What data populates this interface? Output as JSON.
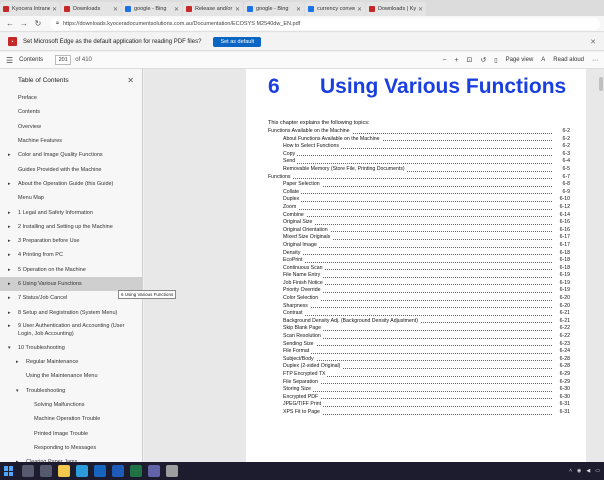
{
  "tabs": [
    {
      "title": "Kyocera Intranet - K",
      "color": "#c62828"
    },
    {
      "title": "Downloads",
      "color": "#c62828"
    },
    {
      "title": "google - Bing",
      "color": "#1a73e8"
    },
    {
      "title": "Release and/or which",
      "color": "#c62828"
    },
    {
      "title": "google - Bing",
      "color": "#1a73e8"
    },
    {
      "title": "currency converter - ",
      "color": "#1a73e8"
    },
    {
      "title": "Downloads | Kyocera",
      "color": "#c62828"
    }
  ],
  "address": {
    "url": "https://downloads.kyoceradocumentsolutions.com.au/Documentation/ECOSYS M2540dw_EN.pdf"
  },
  "infobar": {
    "message": "Set Microsoft Edge as the default application for reading PDF files?",
    "button": "Set as default"
  },
  "pdf_toolbar": {
    "contents_label": "Contents",
    "page_current": "201",
    "page_total": "of 410",
    "page_view": "Page view",
    "read_aloud": "Read aloud"
  },
  "sidebar": {
    "title": "Table of Contents",
    "items": [
      {
        "label": "Preface",
        "level": 0,
        "caret": ""
      },
      {
        "label": "Contents",
        "level": 0,
        "caret": ""
      },
      {
        "label": "Overview",
        "level": 0,
        "caret": ""
      },
      {
        "label": "Machine Features",
        "level": 0,
        "caret": ""
      },
      {
        "label": "Color and Image Quality Functions",
        "level": 0,
        "caret": "▸"
      },
      {
        "label": "Guides Provided with the Machine",
        "level": 0,
        "caret": ""
      },
      {
        "label": "About the Operation Guide (this Guide)",
        "level": 0,
        "caret": "▸"
      },
      {
        "label": "Menu Map",
        "level": 0,
        "caret": ""
      },
      {
        "label": "1 Legal and Safety Information",
        "level": 0,
        "caret": "▸"
      },
      {
        "label": "2 Installing and Setting up the Machine",
        "level": 0,
        "caret": "▸"
      },
      {
        "label": "3 Preparation before Use",
        "level": 0,
        "caret": "▸"
      },
      {
        "label": "4 Printing from PC",
        "level": 0,
        "caret": "▸"
      },
      {
        "label": "5 Operation on the Machine",
        "level": 0,
        "caret": "▸"
      },
      {
        "label": "6 Using Various Functions",
        "level": 0,
        "caret": "▸",
        "selected": true
      },
      {
        "label": "7 Status/Job Cancel",
        "level": 0,
        "caret": "▸"
      },
      {
        "label": "8 Setup and Registration (System Menu)",
        "level": 0,
        "caret": "▸"
      },
      {
        "label": "9 User Authentication and Accounting (User Login, Job Accounting)",
        "level": 0,
        "caret": "▸",
        "tall": true
      },
      {
        "label": "10 Troubleshooting",
        "level": 0,
        "caret": "▾"
      },
      {
        "label": "Regular Maintenance",
        "level": 1,
        "caret": "▸"
      },
      {
        "label": "Using the Maintenance Menu",
        "level": 1,
        "caret": ""
      },
      {
        "label": "Troubleshooting",
        "level": 1,
        "caret": "▾"
      },
      {
        "label": "Solving Malfunctions",
        "level": 2,
        "caret": ""
      },
      {
        "label": "Machine Operation Trouble",
        "level": 2,
        "caret": ""
      },
      {
        "label": "Printed Image Trouble",
        "level": 2,
        "caret": ""
      },
      {
        "label": "Responding to Messages",
        "level": 2,
        "caret": ""
      },
      {
        "label": "Clearing Paper Jams",
        "level": 1,
        "caret": "▸"
      }
    ],
    "tooltip": "6 Using Various Functions"
  },
  "document": {
    "chapter_number": "6",
    "chapter_title": "Using Various Functions",
    "intro": "This chapter explains the following topics:",
    "toc": [
      {
        "text": "Functions Available on the Machine",
        "page": "6-2",
        "level": 0
      },
      {
        "text": "About Functions Available on the Machine",
        "page": "6-2",
        "level": 1
      },
      {
        "text": "How to Select Functions",
        "page": "6-2",
        "level": 1
      },
      {
        "text": "Copy",
        "page": "6-3",
        "level": 1
      },
      {
        "text": "Send",
        "page": "6-4",
        "level": 1
      },
      {
        "text": "Removable Memory (Store File, Printing Documents)",
        "page": "6-5",
        "level": 1
      },
      {
        "text": "Functions",
        "page": "6-7",
        "level": 0
      },
      {
        "text": "Paper Selection",
        "page": "6-8",
        "level": 1
      },
      {
        "text": "Collate",
        "page": "6-9",
        "level": 1
      },
      {
        "text": "Duplex",
        "page": "6-10",
        "level": 1
      },
      {
        "text": "Zoom",
        "page": "6-12",
        "level": 1
      },
      {
        "text": "Combine",
        "page": "6-14",
        "level": 1
      },
      {
        "text": "Original Size",
        "page": "6-16",
        "level": 1
      },
      {
        "text": "Original Orientation",
        "page": "6-16",
        "level": 1
      },
      {
        "text": "Mixed Size Originals",
        "page": "6-17",
        "level": 1
      },
      {
        "text": "Original Image",
        "page": "6-17",
        "level": 1
      },
      {
        "text": "Density",
        "page": "6-18",
        "level": 1
      },
      {
        "text": "EcoPrint",
        "page": "6-18",
        "level": 1
      },
      {
        "text": "Continuous Scan",
        "page": "6-18",
        "level": 1
      },
      {
        "text": "File Name Entry",
        "page": "6-19",
        "level": 1
      },
      {
        "text": "Job Finish Notice",
        "page": "6-19",
        "level": 1
      },
      {
        "text": "Priority Override",
        "page": "6-19",
        "level": 1
      },
      {
        "text": "Color Selection",
        "page": "6-20",
        "level": 1
      },
      {
        "text": "Sharpness",
        "page": "6-20",
        "level": 1
      },
      {
        "text": "Contrast",
        "page": "6-21",
        "level": 1
      },
      {
        "text": "Background Density Adj. (Background Density Adjustment)",
        "page": "6-21",
        "level": 1
      },
      {
        "text": "Skip Blank Page",
        "page": "6-22",
        "level": 1
      },
      {
        "text": "Scan Resolution",
        "page": "6-22",
        "level": 1
      },
      {
        "text": "Sending Size",
        "page": "6-23",
        "level": 1
      },
      {
        "text": "File Format",
        "page": "6-24",
        "level": 1
      },
      {
        "text": "Subject/Body",
        "page": "6-28",
        "level": 1
      },
      {
        "text": "Duplex (2-sided Original)",
        "page": "6-28",
        "level": 1
      },
      {
        "text": "FTP Encrypted TX",
        "page": "6-29",
        "level": 1
      },
      {
        "text": "File Separation",
        "page": "6-29",
        "level": 1
      },
      {
        "text": "Storing Size",
        "page": "6-30",
        "level": 1
      },
      {
        "text": "Encrypted PDF",
        "page": "6-30",
        "level": 1
      },
      {
        "text": "JPEG/TIFF Print",
        "page": "6-31",
        "level": 1
      },
      {
        "text": "XPS Fit to Page",
        "page": "6-31",
        "level": 1
      }
    ]
  },
  "taskbar": {
    "icons": [
      {
        "name": "search",
        "color": "#555a6e"
      },
      {
        "name": "task-view",
        "color": "#555a6e"
      },
      {
        "name": "file-explorer",
        "color": "#f2c94c"
      },
      {
        "name": "edge",
        "color": "#2d9cdb"
      },
      {
        "name": "outlook",
        "color": "#1565c0"
      },
      {
        "name": "word",
        "color": "#1e5bb8"
      },
      {
        "name": "excel",
        "color": "#217346"
      },
      {
        "name": "teams",
        "color": "#6264a7"
      },
      {
        "name": "settings",
        "color": "#9e9e9e"
      }
    ]
  }
}
